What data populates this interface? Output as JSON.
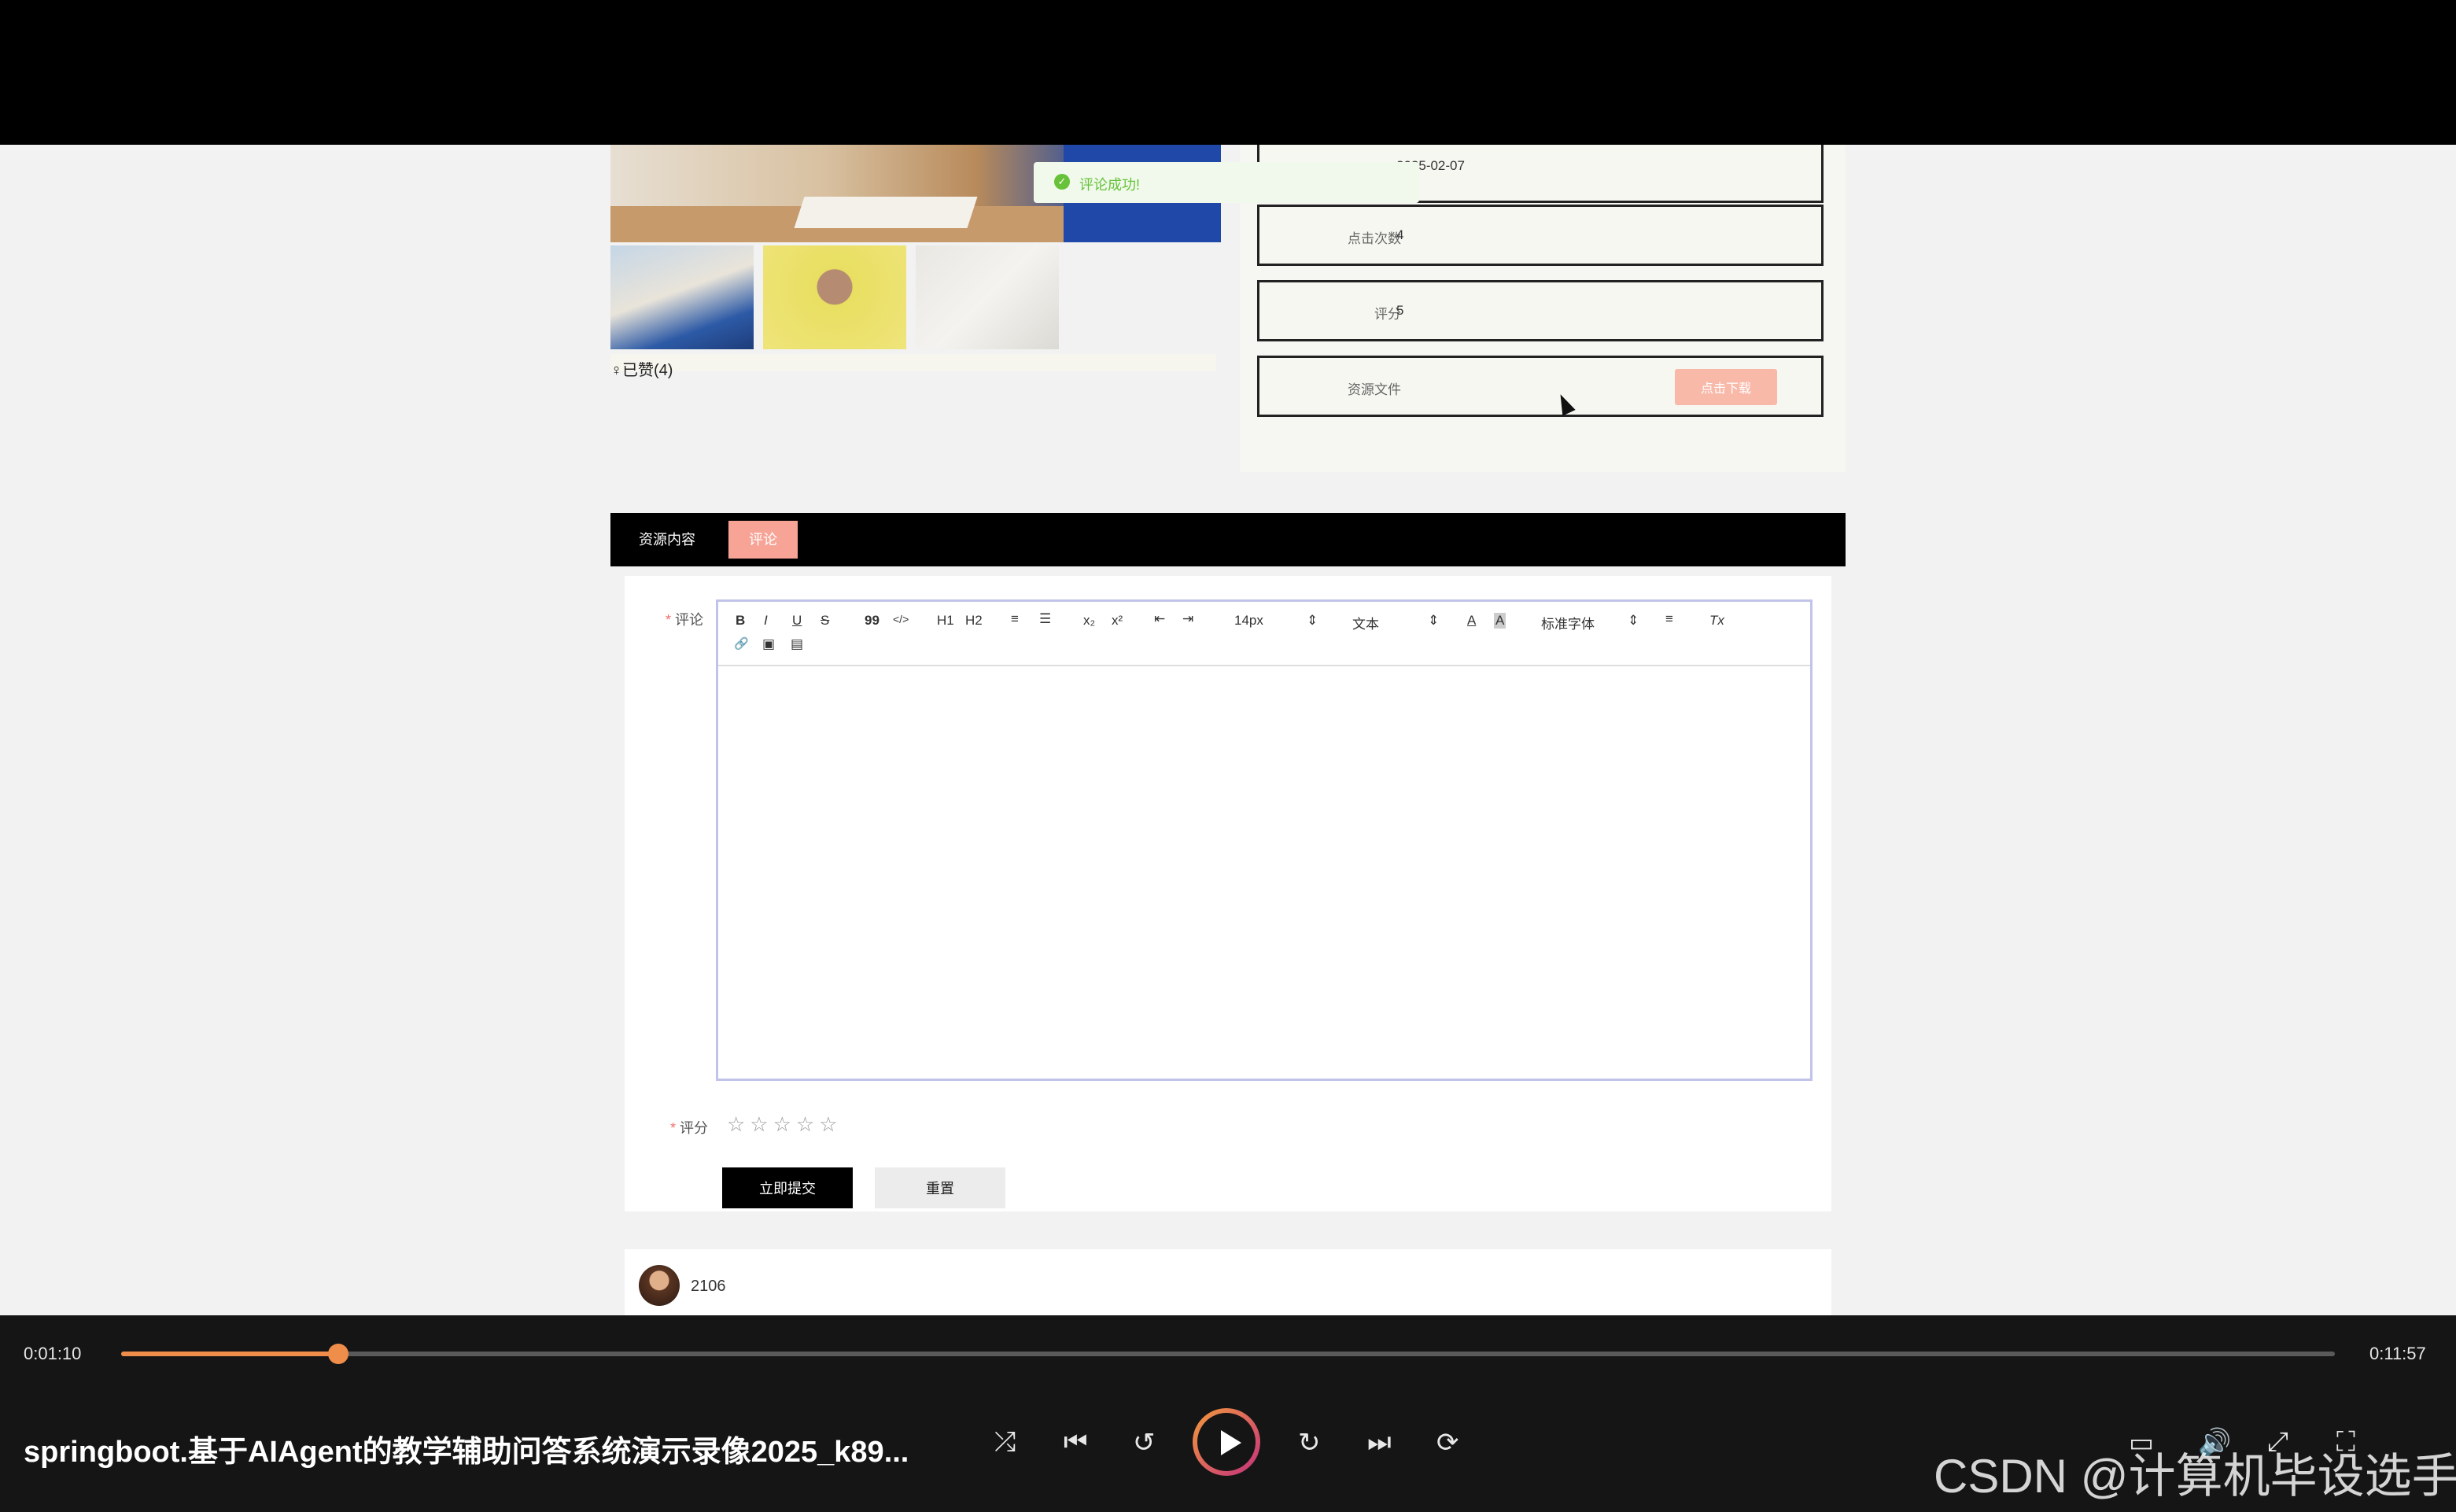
{
  "toast": {
    "message": "评论成功!"
  },
  "gallery": {
    "liked_label": "♀已赞(4)"
  },
  "info": {
    "date_value": "2025-02-07",
    "clicks_label": "点击次数",
    "clicks_value": "4",
    "rating_label": "评分",
    "rating_value": "5",
    "file_label": "资源文件",
    "download_label": "点击下载"
  },
  "tabs": [
    {
      "label": "资源内容"
    },
    {
      "label": "评论"
    }
  ],
  "form": {
    "comment_label": "评论",
    "rating_label": "评分",
    "submit_label": "立即提交",
    "reset_label": "重置",
    "required_mark": "*",
    "stars": "☆☆☆☆☆"
  },
  "toolbar": {
    "bold": "B",
    "italic": "I",
    "underline": "U",
    "strike": "S",
    "quote": "99",
    "code": "</>",
    "h1": "H1",
    "h2": "H2",
    "ordered_list": "≡",
    "bullet_list": "☰",
    "subscript": "x₂",
    "superscript": "x²",
    "outdent": "⇤",
    "indent": "⇥",
    "font_size": "14px",
    "format": "文本",
    "font_family": "标准字体",
    "font_color": "A",
    "bg_color": "A",
    "align": "≡",
    "clear": "Tx",
    "link": "🔗",
    "image": "▣",
    "video": "▤"
  },
  "comments": [
    {
      "name": "2106"
    }
  ],
  "player": {
    "current_time": "0:01:10",
    "total_time": "0:11:57",
    "progress": 0.098,
    "title": "springboot.基于AIAgent的教学辅助问答系统演示录像2025_k89...",
    "watermark": "CSDN @计算机毕设选手"
  },
  "colors": {
    "accent_pink": "#f7a497",
    "download_pink": "#f9b9a9",
    "success_green": "#67c23a",
    "player_orange": "#ef8e4a"
  }
}
